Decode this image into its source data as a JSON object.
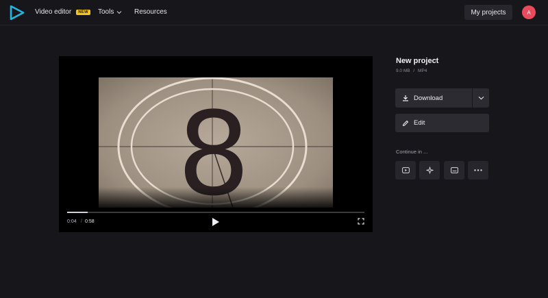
{
  "header": {
    "nav": {
      "video_editor": "Video editor",
      "video_editor_badge": "NEW",
      "tools": "Tools",
      "resources": "Resources"
    },
    "my_projects": "My projects",
    "avatar_initial": "A"
  },
  "player": {
    "current_time": "0:04",
    "separator": "/",
    "total_time": "0:58",
    "progress_fraction": 0.069,
    "frame_digit": "8"
  },
  "project": {
    "title": "New project",
    "size": "9.0 MB",
    "meta_separator": "/",
    "format": "MP4"
  },
  "actions": {
    "download": "Download",
    "edit": "Edit",
    "continue_in": "Continue in ..."
  },
  "colors": {
    "background": "#17171b",
    "button": "#2b2b31",
    "accent_logo": "#1fb6e0",
    "badge": "#f5c518",
    "avatar": "#ea4b5c"
  },
  "icons": {
    "logo": "play-triangle-logo",
    "tools_chevron": "chevron-down-icon",
    "play": "play-icon",
    "fullscreen": "fullscreen-icon",
    "download": "download-icon",
    "download_toggle": "chevron-down-icon",
    "edit": "pencil-icon",
    "continue": [
      "youtube-icon",
      "sparkle-icon",
      "subtitles-icon",
      "more-icon"
    ]
  }
}
